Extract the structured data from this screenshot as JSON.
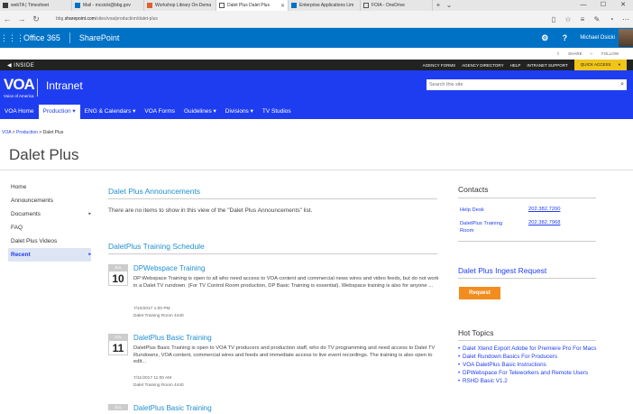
{
  "browser": {
    "tabs": [
      {
        "label": "webTA | Timesheet",
        "color": "#3a3a3a",
        "active": false
      },
      {
        "label": "Mail - mcsicki@bbg.gov",
        "color": "#0072c6",
        "active": false
      },
      {
        "label": "Workshop Library On-Dema",
        "color": "#e06030",
        "active": false
      },
      {
        "label": "Dalet Plus Dalet Plus",
        "color": "#555555",
        "active": true
      },
      {
        "label": "Enterprise Applications Lim",
        "color": "#0072c6",
        "active": false
      },
      {
        "label": "FOIA - OneDrive",
        "color": "#555555",
        "active": false
      }
    ],
    "url_prefix": "bbg.",
    "url_domain": "sharepoint.com",
    "url_path": "/sites/voa/production/dalet-plus"
  },
  "suite": {
    "office": "Office 365",
    "app": "SharePoint",
    "user": "Michael Osicki"
  },
  "share_row": {
    "share": "SHARE",
    "follow": "FOLLOW"
  },
  "inside_bar": {
    "label": "INSIDE",
    "links": [
      "AGENCY FORMS",
      "AGENCY DIRECTORY",
      "HELP",
      "INTRANET SUPPORT"
    ],
    "quick_access": "QUICK ACCESS"
  },
  "header": {
    "logo": "VOA",
    "logo_sub": "Voice of America",
    "site": "Intranet",
    "search_placeholder": "Search this site"
  },
  "nav": [
    "VOA Home",
    "Production ▾",
    "ENG & Calendars ▾",
    "VOA Forms",
    "Guidelines ▾",
    "Divisions ▾",
    "TV Studios"
  ],
  "breadcrumb": {
    "root": "VOA",
    "sep1": " > ",
    "mid": "Production",
    "sep2": " > ",
    "current": "Dalet Plus"
  },
  "page_title": "Dalet Plus",
  "left_nav": [
    {
      "label": "Home",
      "chev": ""
    },
    {
      "label": "Announcements",
      "chev": ""
    },
    {
      "label": "Documents",
      "chev": "▸"
    },
    {
      "label": "FAQ",
      "chev": ""
    },
    {
      "label": "Dalet Plus Videos",
      "chev": ""
    },
    {
      "label": "Recent",
      "chev": "▸"
    }
  ],
  "announcements": {
    "title": "Dalet Plus Announcements",
    "empty": "There are no items to show in this view of the \"Dalet Plus Announcements\" list."
  },
  "schedule": {
    "title": "DaletPlus Training Schedule",
    "events": [
      {
        "month": "JUL",
        "day": "10",
        "title": "DPWebspace Training",
        "desc": "DP Webspace Training is open to all who need access to VOA content and commercial news wires and video feeds, but do not work in a Dalet TV rundown. (For TV Control Room production, DP Basic Training is essential). Webspace training is also for anyone ...",
        "time": "7/10/2017 1:00 PM",
        "room": "Dalet Training Room 4440"
      },
      {
        "month": "JUL",
        "day": "11",
        "title": "DaletPlus Basic Training",
        "desc": "DaletPlus Basic Training is open to VOA TV producers and production staff, who do TV programming and need access to Dalet TV Rundowns, VOA content, commercial wires and feeds and immediate access to live event recordings. The training is also open to edit...",
        "time": "7/11/2017 11:00 AM",
        "room": "Dalet Training Room 4440"
      },
      {
        "month": "JUL",
        "day": "",
        "title": "DaletPlus Basic Training",
        "desc": "",
        "time": "",
        "room": ""
      }
    ]
  },
  "contacts": {
    "title": "Contacts",
    "items": [
      {
        "label": "Help Desk",
        "phone": "202.382.7200"
      },
      {
        "label": "DaletPlus Training Room",
        "phone": "202.382.7968"
      }
    ]
  },
  "ingest": {
    "title": "Dalet Plus Ingest Request",
    "button": "Request"
  },
  "hot_topics": {
    "title": "Hot Topics",
    "items": [
      "Dalet Xtend Export Adobe for Premiere Pro For Macs",
      "Dalet Rundown Basics For Producers",
      "VOA DaletPlus Basic Instructions",
      "DPWebspace For Teleworkers and Remote Users",
      "RSHD Basic V1.2"
    ]
  }
}
